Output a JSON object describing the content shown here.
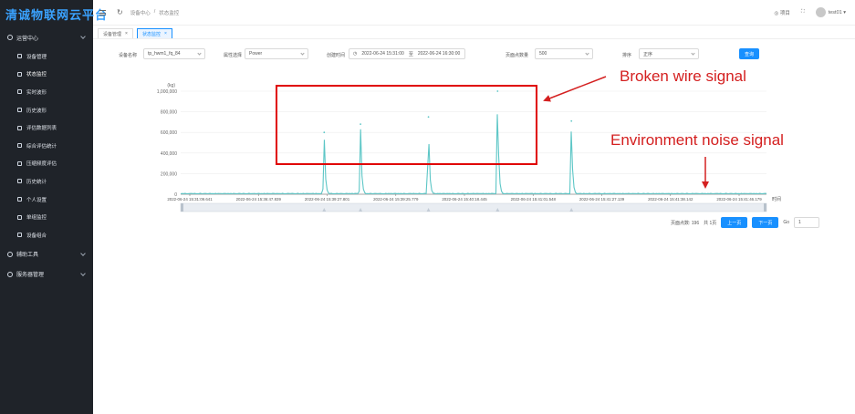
{
  "brand": {
    "title": "清诚物联网云平台"
  },
  "sidebar": {
    "groups": [
      {
        "label": "运营中心"
      },
      {
        "label": "辅助工具"
      },
      {
        "label": "服务器管理"
      }
    ],
    "items": [
      {
        "label": "设备管理"
      },
      {
        "label": "状态监控"
      },
      {
        "label": "实时波形"
      },
      {
        "label": "历史波形"
      },
      {
        "label": "评估数据列表"
      },
      {
        "label": "综合评估统计"
      },
      {
        "label": "压缩频度评估"
      },
      {
        "label": "历史统计"
      },
      {
        "label": "个人设置"
      },
      {
        "label": "单组监控"
      },
      {
        "label": "设备组合"
      }
    ]
  },
  "header": {
    "crumbs": [
      "设备中心",
      "/",
      "状态监控"
    ],
    "right_link": "◎ 项目",
    "user": "test01"
  },
  "tabs": [
    {
      "label": "设备管理",
      "active": false
    },
    {
      "label": "状态监控",
      "active": true
    }
  ],
  "filters": {
    "device_label": "设备名称",
    "device_value": "tp_hwm1_fq_84",
    "attr_label": "属性选择",
    "attr_value": "Power",
    "time_label": "创建时间",
    "time_start": "2022-06-24 15:31:00",
    "time_sep": "至",
    "time_end": "2022-06-24 16:30:00",
    "count_label": "页面点数量",
    "count_value": "500",
    "sort_label": "排序",
    "sort_value": "正序",
    "query_label": "查询"
  },
  "chart_data": {
    "type": "line",
    "ylabel": "(kg)",
    "xlabel": "时间",
    "ylim": [
      0,
      1000000
    ],
    "y_ticks": [
      "0",
      "200,000",
      "400,000",
      "600,000",
      "800,000",
      "1,000,000"
    ],
    "x_ticks": [
      "2022-06-24 15:31:09.641",
      "2022-06-24 15:36:47.839",
      "2022-06-24 15:39:27.801",
      "2022-06-24 15:39:25.779",
      "2022-06-24 15:40:18.445",
      "2022-06-24 15:41:01.548",
      "2022-06-24 15:41:27.139",
      "2022-06-24 15:41:38.142",
      "2022-06-24 15:41:46.179"
    ],
    "peaks": [
      {
        "x": 0.245,
        "value": 600000
      },
      {
        "x": 0.307,
        "value": 680000
      },
      {
        "x": 0.423,
        "value": 750000
      },
      {
        "x": 0.541,
        "value": 1000000
      },
      {
        "x": 0.667,
        "value": 710000
      }
    ],
    "baseline_noise": 9000,
    "line_color": "#5cc6c6"
  },
  "pager": {
    "total_label": "页面点数: 196",
    "pages_label": "共 1页",
    "prev_label": "上一页",
    "next_label": "下一页",
    "go_label": "Go",
    "page_value": "1"
  },
  "annotations": {
    "broken": "Broken wire signal",
    "noise": "Environment noise signal",
    "color": "#d42020"
  }
}
